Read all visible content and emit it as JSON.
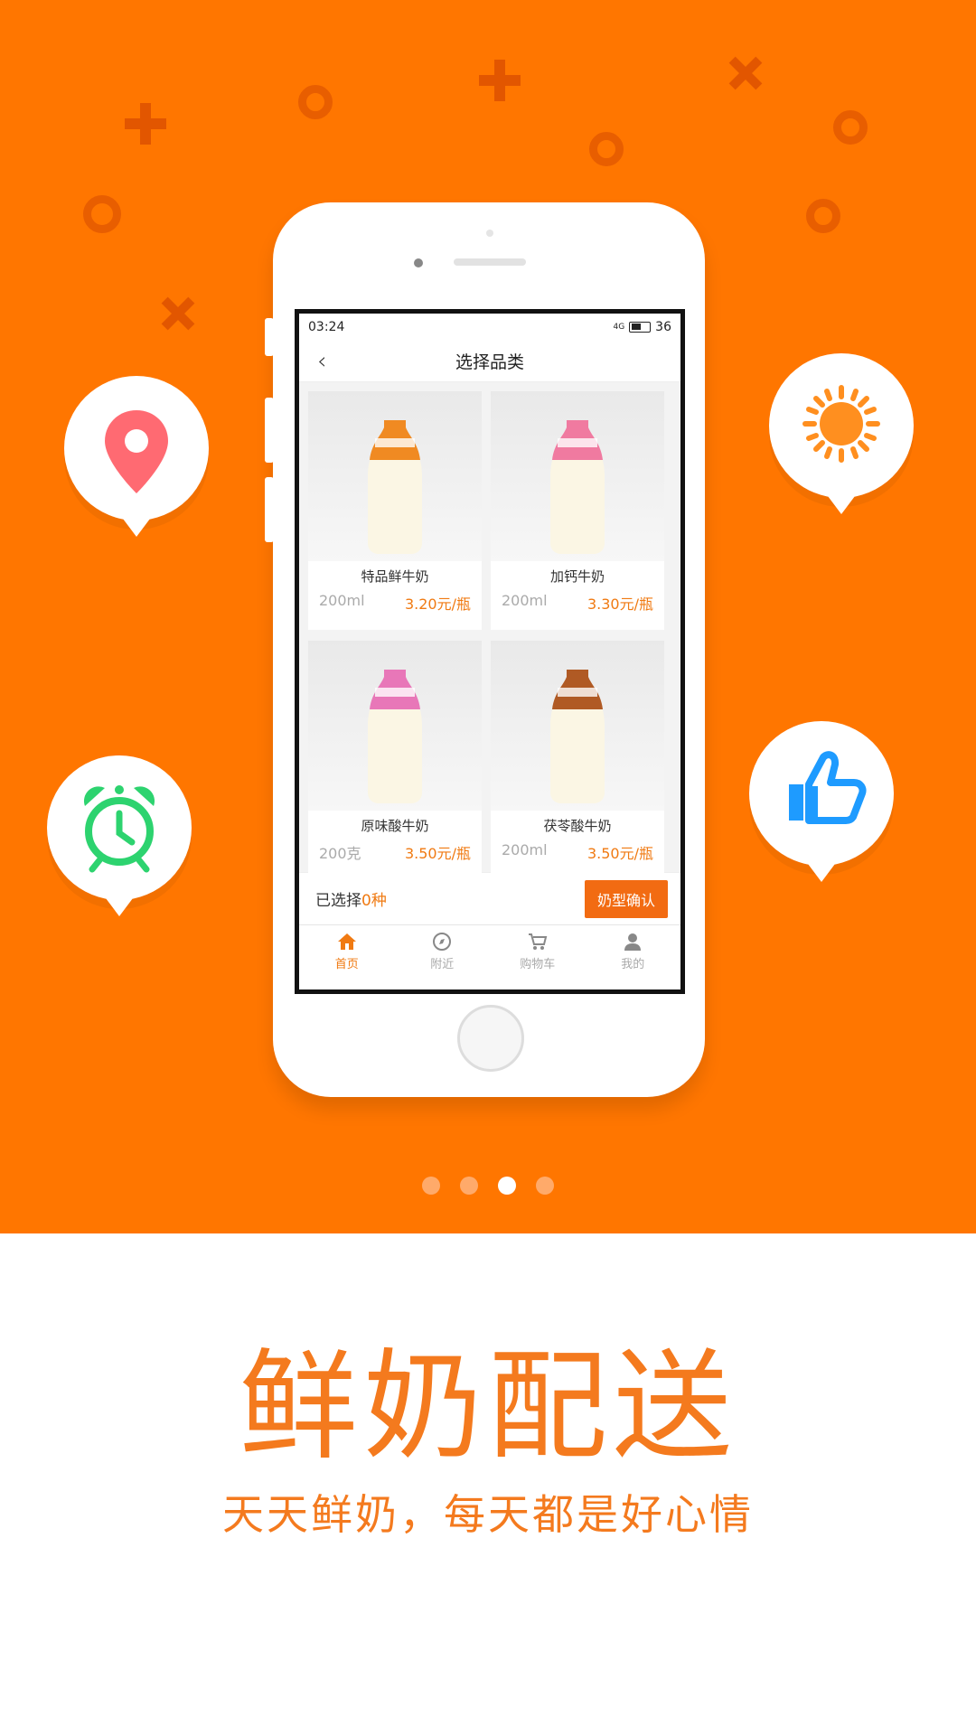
{
  "hero": {
    "bg_color": "#FF7600",
    "bubbles": [
      {
        "icon": "location-pin-icon",
        "color": "#FF6A72"
      },
      {
        "icon": "alarm-clock-icon",
        "color": "#2DD36F"
      },
      {
        "icon": "sun-icon",
        "color": "#FF8F1F"
      },
      {
        "icon": "thumbs-up-icon",
        "color": "#1E9BFF"
      }
    ]
  },
  "phone": {
    "status": {
      "time": "03:24",
      "signal": "4G",
      "battery": "36"
    },
    "nav": {
      "title": "选择品类",
      "back_icon": "back-arrow-icon"
    },
    "products": [
      {
        "name": "特品鲜牛奶",
        "size": "200ml",
        "price": "3.20元/瓶",
        "label_color": "#F08A22"
      },
      {
        "name": "加钙牛奶",
        "size": "200ml",
        "price": "3.30元/瓶",
        "label_color": "#F07AA0"
      },
      {
        "name": "原味酸牛奶",
        "size": "200克",
        "price": "3.50元/瓶",
        "label_color": "#E877B8"
      },
      {
        "name": "茯苓酸牛奶",
        "size": "200ml",
        "price": "3.50元/瓶",
        "label_color": "#B05A24"
      }
    ],
    "selection": {
      "prefix": "已选择",
      "count": "0种",
      "confirm_label": "奶型确认"
    },
    "tabs": [
      {
        "label": "首页",
        "icon": "home-icon",
        "active": true
      },
      {
        "label": "附近",
        "icon": "compass-icon",
        "active": false
      },
      {
        "label": "购物车",
        "icon": "cart-icon",
        "active": false
      },
      {
        "label": "我的",
        "icon": "user-icon",
        "active": false
      }
    ]
  },
  "pager": {
    "count": 4,
    "active_index": 2
  },
  "headline": "鲜奶配送",
  "subtitle": "天天鲜奶，每天都是好心情"
}
